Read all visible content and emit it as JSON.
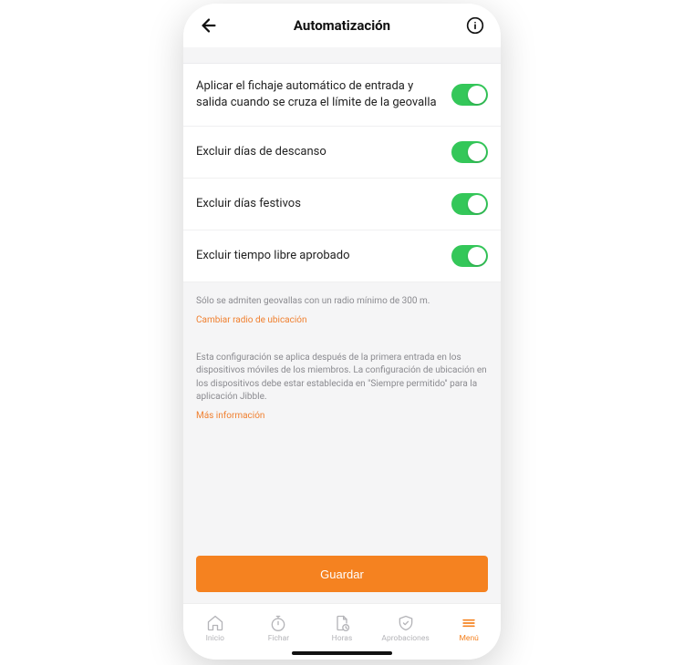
{
  "header": {
    "title": "Automatización"
  },
  "settings": [
    {
      "label": "Aplicar el fichaje automático de entrada y salida cuando se cruza el límite de la geovalla",
      "on": true
    },
    {
      "label": "Excluir días de descanso",
      "on": true
    },
    {
      "label": "Excluir días festivos",
      "on": true
    },
    {
      "label": "Excluir tiempo libre aprobado",
      "on": true
    }
  ],
  "info1": {
    "text": "Sólo se admiten geovallas con un radio mínimo de 300 m.",
    "link": "Cambiar radio de ubicación"
  },
  "info2": {
    "text": "Esta configuración se aplica después de la primera entrada en los dispositivos móviles de los miembros. La configuración de ubicación en los dispositivos debe estar establecida en \"Siempre permitido\" para la aplicación Jibble.",
    "link": "Más información"
  },
  "actions": {
    "save": "Guardar"
  },
  "tabs": {
    "home": "Inicio",
    "clock": "Fichar",
    "hours": "Horas",
    "approvals": "Aprobaciones",
    "menu": "Menú"
  }
}
